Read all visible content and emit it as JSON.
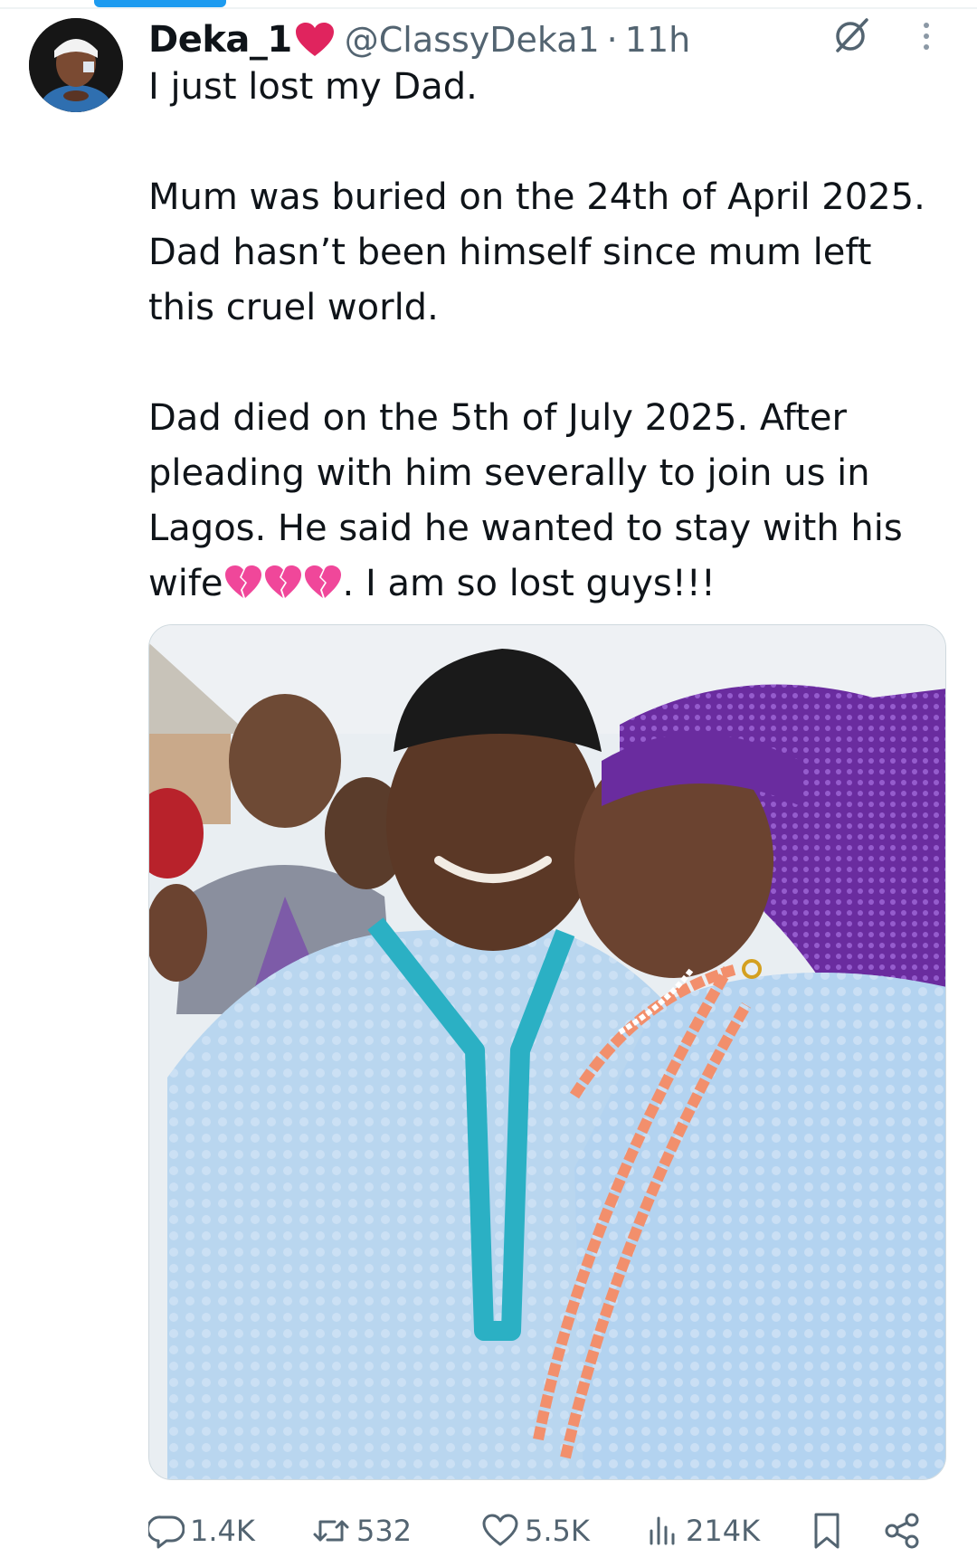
{
  "tweet": {
    "display_name": "Deka_1",
    "name_emoji": "red-heart",
    "handle": "@ClassyDeka1",
    "separator": "·",
    "timestamp": "11h",
    "paragraphs": [
      "I just lost my Dad.",
      "Mum was buried on the 24th of April 2025. Dad hasn’t been himself since mum left this cruel world.",
      "Dad died on the 5th of July 2025. After pleading with him severally to join us in Lagos. He said he wanted to stay with his wife"
    ],
    "closing_text": ". I am so lost guys!!!",
    "media": {
      "icon": "photo"
    }
  },
  "actions": {
    "replies": "1.4K",
    "reposts": "532",
    "likes": "5.5K",
    "views": "214K"
  },
  "icons": {
    "grok": "grok-icon",
    "more": "more-vertical-icon",
    "reply": "reply-icon",
    "repost": "repost-icon",
    "like": "heart-icon",
    "views": "views-icon",
    "bookmark": "bookmark-icon",
    "share": "share-icon"
  },
  "colors": {
    "text": "#0f1419",
    "secondary": "#536471",
    "accent": "#1d9bf0",
    "heart": "#e0245e",
    "broken_heart": "#f0479a"
  }
}
